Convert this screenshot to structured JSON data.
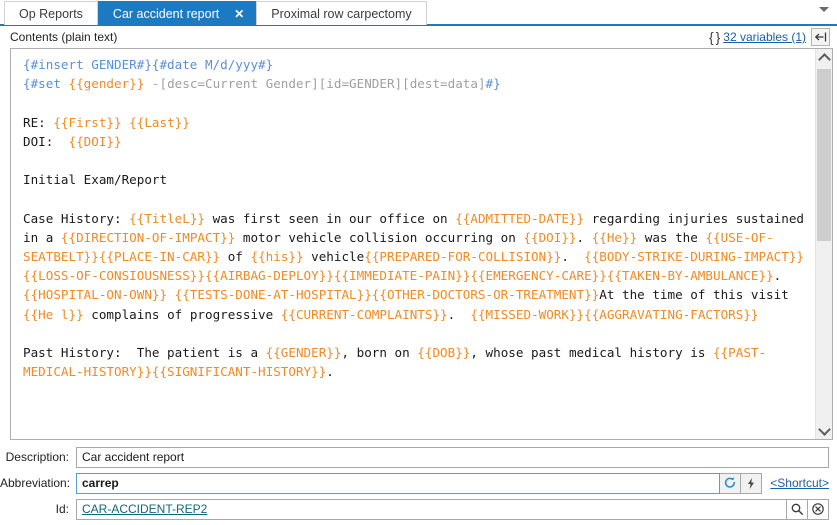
{
  "tabs": [
    {
      "label": "Op Reports",
      "active": false,
      "closable": false
    },
    {
      "label": "Car accident report",
      "active": true,
      "closable": true,
      "close_glyph": "✕"
    },
    {
      "label": "Proximal row carpectomy",
      "active": false,
      "closable": false
    }
  ],
  "contents": {
    "label": "Contents (plain text)",
    "braces_glyph": "{ }",
    "variables_link": "32 variables (1)",
    "insert_icon": "insert-field-icon"
  },
  "editor": {
    "lines": [
      [
        {
          "t": "{#insert GENDER#}{#date M/d/yyy#}",
          "s": "c"
        }
      ],
      [
        {
          "t": "{#set ",
          "s": "c"
        },
        {
          "t": "{{gender}}",
          "s": "v"
        },
        {
          "t": " -[desc=Current Gender][id=GENDER][dest=data]",
          "s": "g"
        },
        {
          "t": "#}",
          "s": "c"
        }
      ],
      [],
      [
        {
          "t": "RE: ",
          "s": ""
        },
        {
          "t": "{{First}} {{Last}}",
          "s": "v"
        }
      ],
      [
        {
          "t": "DOI:  ",
          "s": ""
        },
        {
          "t": "{{DOI}}",
          "s": "v"
        }
      ],
      [],
      [
        {
          "t": "Initial Exam/Report",
          "s": ""
        }
      ],
      [],
      [
        {
          "t": "Case History: ",
          "s": ""
        },
        {
          "t": "{{TitleL}}",
          "s": "v"
        },
        {
          "t": " was first seen in our office on ",
          "s": ""
        },
        {
          "t": "{{ADMITTED-DATE}}",
          "s": "v"
        },
        {
          "t": " regarding injuries sustained in a ",
          "s": ""
        },
        {
          "t": "{{DIRECTION-OF-IMPACT}}",
          "s": "v"
        },
        {
          "t": " motor vehicle collision occurring on ",
          "s": ""
        },
        {
          "t": "{{DOI}}",
          "s": "v"
        },
        {
          "t": ". ",
          "s": ""
        },
        {
          "t": "{{He}}",
          "s": "v"
        },
        {
          "t": " was the ",
          "s": ""
        },
        {
          "t": "{{USE-OF-SEATBELT}}{{PLACE-IN-CAR}}",
          "s": "v"
        },
        {
          "t": " of ",
          "s": ""
        },
        {
          "t": "{{his}}",
          "s": "v"
        },
        {
          "t": " vehicle",
          "s": ""
        },
        {
          "t": "{{PREPARED-FOR-COLLISION}}",
          "s": "v"
        },
        {
          "t": ".  ",
          "s": ""
        },
        {
          "t": "{{BODY-STRIKE-DURING-IMPACT}}{{LOSS-OF-CONSIOUSNESS}}{{AIRBAG-DEPLOY}}{{IMMEDIATE-PAIN}}{{EMERGENCY-CARE}}{{TAKEN-BY-AMBULANCE}}",
          "s": "v"
        },
        {
          "t": ".  ",
          "s": ""
        },
        {
          "t": "{{HOSPITAL-ON-OWN}} {{TESTS-DONE-AT-HOSPITAL}}{{OTHER-DOCTORS-OR-TREATMENT}}",
          "s": "v"
        },
        {
          "t": "At the time of this visit ",
          "s": ""
        },
        {
          "t": "{{He l}}",
          "s": "v"
        },
        {
          "t": " complains of progressive ",
          "s": ""
        },
        {
          "t": "{{CURRENT-COMPLAINTS}}",
          "s": "v"
        },
        {
          "t": ".  ",
          "s": ""
        },
        {
          "t": "{{MISSED-WORK}}{{AGGRAVATING-FACTORS}}",
          "s": "v"
        }
      ],
      [],
      [
        {
          "t": "Past History:  The patient is a ",
          "s": ""
        },
        {
          "t": "{{GENDER}}",
          "s": "v"
        },
        {
          "t": ", born on ",
          "s": ""
        },
        {
          "t": "{{DOB}}",
          "s": "v"
        },
        {
          "t": ", whose past medical history is ",
          "s": ""
        },
        {
          "t": "{{PAST-MEDICAL-HISTORY}}{{SIGNIFICANT-HISTORY}}",
          "s": "v"
        },
        {
          "t": ".",
          "s": ""
        }
      ]
    ],
    "scrollbar": {
      "up_icon": "chevron-up-icon",
      "down_icon": "chevron-down-icon"
    }
  },
  "form": {
    "description": {
      "label": "Description:",
      "value": "Car accident report",
      "placeholder": ""
    },
    "abbreviation": {
      "label": "Abbreviation:",
      "value": "carrep",
      "placeholder": "",
      "refresh_icon": "refresh-icon",
      "lightning_icon": "lightning-bolt-icon",
      "shortcut_link": "<Shortcut>"
    },
    "id": {
      "label": "Id:",
      "value": "CAR-ACCIDENT-REP2",
      "placeholder": "",
      "search_icon": "search-icon",
      "clear_icon": "clear-circle-icon"
    }
  },
  "colors": {
    "accent": "#1d79c0",
    "variable": "#f08a24",
    "command": "#5a8fd6",
    "link": "#1a5fa8",
    "id_link": "#10697a"
  }
}
